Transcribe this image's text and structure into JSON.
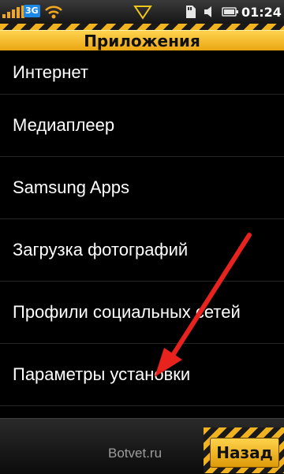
{
  "status_bar": {
    "network_type": "3G",
    "time": "01:24",
    "icons": [
      "signal-icon",
      "wifi-icon",
      "notification-arrow-icon",
      "sd-card-icon",
      "volume-icon",
      "battery-icon"
    ]
  },
  "header": {
    "title": "Приложения"
  },
  "menu": {
    "items": [
      {
        "label": "Интернет"
      },
      {
        "label": "Медиаплеер"
      },
      {
        "label": "Samsung Apps"
      },
      {
        "label": "Загрузка фотографий"
      },
      {
        "label": "Профили социальных сетей"
      },
      {
        "label": "Параметры установки"
      }
    ]
  },
  "footer": {
    "back_label": "Назад",
    "watermark": "Botvet.ru"
  },
  "colors": {
    "accent_yellow": "#f0b21e",
    "annotation_red": "#e8221c",
    "list_background": "#000000",
    "text": "#ffffff"
  }
}
